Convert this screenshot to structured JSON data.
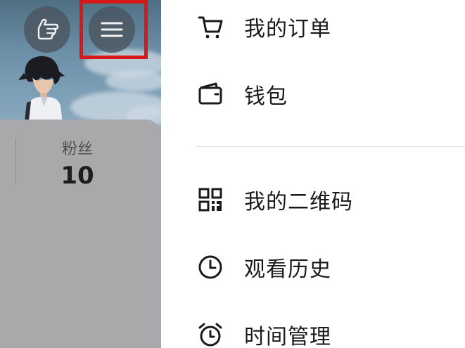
{
  "profile": {
    "stats": [
      {
        "label": "粉丝",
        "count": "10"
      }
    ]
  },
  "toolbar": {
    "hand_icon": "pointing-hand-icon",
    "menu_icon": "hamburger-menu-icon",
    "highlight_color": "#d81818"
  },
  "menu": {
    "items": [
      {
        "label": "我的订单",
        "icon": "cart-icon"
      },
      {
        "label": "钱包",
        "icon": "wallet-icon"
      },
      {
        "label": "我的二维码",
        "icon": "qr-code-icon"
      },
      {
        "label": "观看历史",
        "icon": "clock-icon"
      },
      {
        "label": "时间管理",
        "icon": "alarm-clock-icon"
      }
    ]
  }
}
